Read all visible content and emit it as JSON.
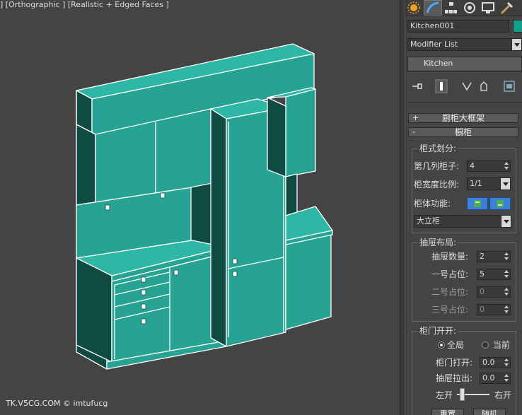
{
  "viewport": {
    "label": "] [Orthographic ] [Realistic + Edged Faces ]",
    "watermark": "TK.V5CG.COM © imtufucg"
  },
  "command_panel": {
    "tabs": [
      {
        "icon": "create-icon"
      },
      {
        "icon": "modify-icon",
        "active": true
      },
      {
        "icon": "hierarchy-icon"
      },
      {
        "icon": "motion-icon"
      },
      {
        "icon": "display-icon"
      },
      {
        "icon": "utilities-icon"
      }
    ],
    "object_name": "Kitchen001",
    "object_color": "#12a08a",
    "modifier_list": "Modifier List",
    "stack_item": "Kitchen",
    "rollout_frame": {
      "sign": "+",
      "title": "厨柜大框架"
    },
    "rollout_cabinet": {
      "sign": "-",
      "title": "橱柜"
    },
    "cabinet_division": {
      "title": "柜式划分:",
      "column_label": "第几列柜子:",
      "column_value": "4",
      "width_ratio_label": "柜宽度比例:",
      "width_ratio_value": "1/1",
      "function_label": "柜体功能:",
      "cabinet_type": "大立柜"
    },
    "drawer_layout": {
      "title": "抽屉布局:",
      "count_label": "抽屉数量:",
      "count_value": "2",
      "slot1_label": "一号占位:",
      "slot1_value": "5",
      "slot2_label": "二号占位:",
      "slot2_value": "0",
      "slot3_label": "三号占位:",
      "slot3_value": "0"
    },
    "door_open": {
      "title": "柜门开开:",
      "radio_global": "全局",
      "radio_current": "当前",
      "door_label": "柜门打开:",
      "door_value": "0.0",
      "drawer_label": "抽屉拉出:",
      "drawer_value": "0.0",
      "left_label": "左开",
      "right_label": "右开",
      "reset_button": "重置",
      "random_button": "随机"
    }
  },
  "colors": {
    "cabinet_face": "#26a393",
    "cabinet_side": "#0f4b42",
    "cabinet_top": "#2eb8a6",
    "edge": "#ffffff",
    "viewport_bg": "#444444"
  }
}
